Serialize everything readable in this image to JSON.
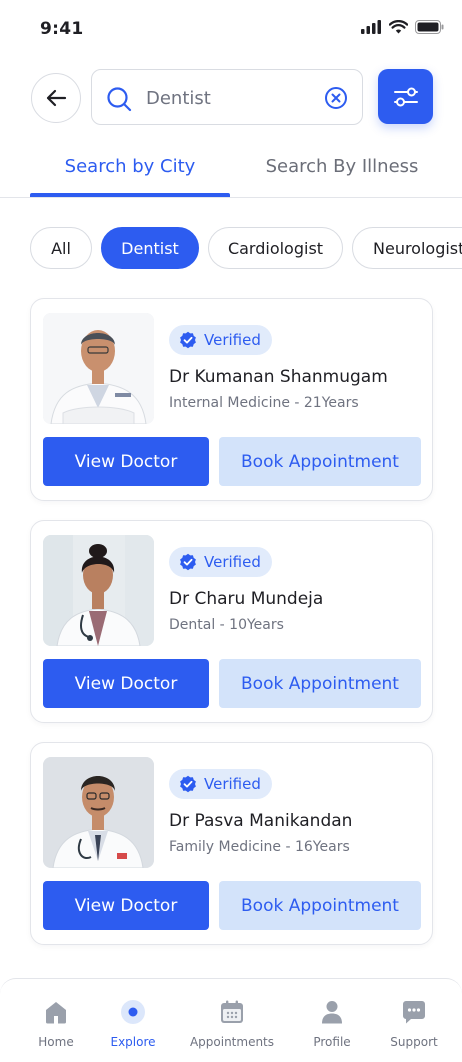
{
  "status_bar": {
    "time": "9:41",
    "icons": [
      "signal-icon",
      "wifi-icon",
      "battery-icon"
    ]
  },
  "header": {
    "back_icon": "arrow-left-icon",
    "search": {
      "value": "Dentist",
      "placeholder": "",
      "icon": "search-icon",
      "clear_icon": "clear-icon"
    },
    "filter_icon": "filter-sliders-icon"
  },
  "tabs": [
    {
      "label": "Search by City",
      "active": true
    },
    {
      "label": "Search By Illness",
      "active": false
    }
  ],
  "chips": [
    {
      "label": "All",
      "active": false
    },
    {
      "label": "Dentist",
      "active": true
    },
    {
      "label": "Cardiologist",
      "active": false
    },
    {
      "label": "Neurologist",
      "active": false
    }
  ],
  "doctors": [
    {
      "badge": "Verified",
      "name": "Dr Kumanan Shanmugam",
      "specialty": "Internal Medicine - 21Years",
      "view_label": "View Doctor",
      "book_label": "Book Appointment"
    },
    {
      "badge": "Verified",
      "name": "Dr Charu Mundeja",
      "specialty": "Dental - 10Years",
      "view_label": "View Doctor",
      "book_label": "Book Appointment"
    },
    {
      "badge": "Verified",
      "name": "Dr Pasva Manikandan",
      "specialty": "Family Medicine - 16Years",
      "view_label": "View Doctor",
      "book_label": "Book Appointment"
    }
  ],
  "bottom_nav": [
    {
      "label": "Home",
      "icon": "home-icon",
      "active": false
    },
    {
      "label": "Explore",
      "icon": "explore-icon",
      "active": true
    },
    {
      "label": "Appointments",
      "icon": "calendar-icon",
      "active": false
    },
    {
      "label": "Profile",
      "icon": "person-icon",
      "active": false
    },
    {
      "label": "Support",
      "icon": "chat-icon",
      "active": false
    }
  ],
  "colors": {
    "primary": "#2d5cf0",
    "primary_light": "#d3e3fa",
    "badge_bg": "#e1ebfb",
    "text": "#1f1f24",
    "muted": "#6f7380",
    "border": "#d9dce2"
  }
}
